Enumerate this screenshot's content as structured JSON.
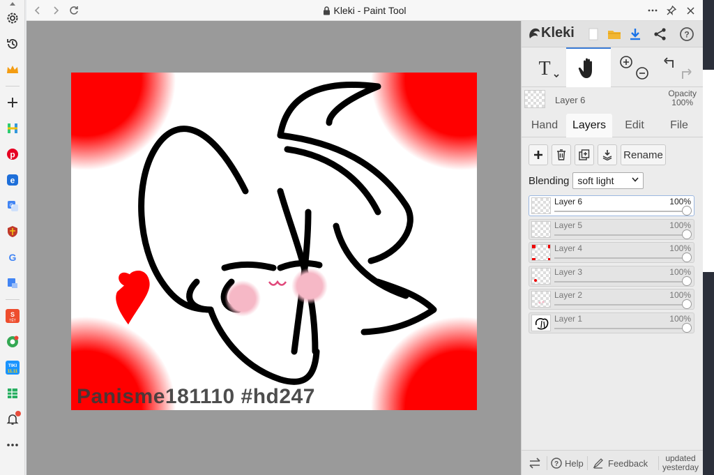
{
  "window": {
    "title": "Kleki - Paint Tool"
  },
  "sidebar": {
    "items": [
      {
        "icon": "settings-icon"
      },
      {
        "icon": "history-icon"
      },
      {
        "icon": "crown-icon"
      },
      {
        "icon": "add-icon"
      },
      {
        "icon": "h-app-icon"
      },
      {
        "icon": "pinterest-icon"
      },
      {
        "icon": "app-e-icon"
      },
      {
        "icon": "translate-icon"
      },
      {
        "icon": "shield-app-icon"
      },
      {
        "icon": "google-icon"
      },
      {
        "icon": "translate-doc-icon"
      },
      {
        "icon": "shopee-icon",
        "label": "TẾT"
      },
      {
        "icon": "chrome-alt-icon"
      },
      {
        "icon": "tiki-icon",
        "label": "TIKI 11.11"
      },
      {
        "icon": "sheet-icon"
      },
      {
        "icon": "bell-icon"
      },
      {
        "icon": "more-icon"
      }
    ],
    "notification_color": "#e74c3c"
  },
  "canvas": {
    "caption": "Panisme181110 #hd247",
    "accent_red": "#ff0000",
    "blush_pink": "#f6b8c6"
  },
  "panel": {
    "logo": "Kleki",
    "active_tool": "Hand",
    "current_layer": "Layer 6",
    "opacity_label": "Opacity",
    "opacity_value": "100%",
    "tabs": [
      "Hand",
      "Layers",
      "Edit",
      "File"
    ],
    "active_tab": "Layers",
    "rename_label": "Rename",
    "blending_label": "Blending",
    "blending_value": "soft light",
    "layers": [
      {
        "name": "Layer 6",
        "opacity": "100%",
        "selected": true
      },
      {
        "name": "Layer 5",
        "opacity": "100%",
        "selected": false
      },
      {
        "name": "Layer 4",
        "opacity": "100%",
        "selected": false
      },
      {
        "name": "Layer 3",
        "opacity": "100%",
        "selected": false
      },
      {
        "name": "Layer 2",
        "opacity": "100%",
        "selected": false
      },
      {
        "name": "Layer 1",
        "opacity": "100%",
        "selected": false
      }
    ],
    "footer": {
      "help": "Help",
      "feedback": "Feedback",
      "updated_line1": "updated",
      "updated_line2": "yesterday"
    },
    "accent_blue": "#1a73e8"
  }
}
